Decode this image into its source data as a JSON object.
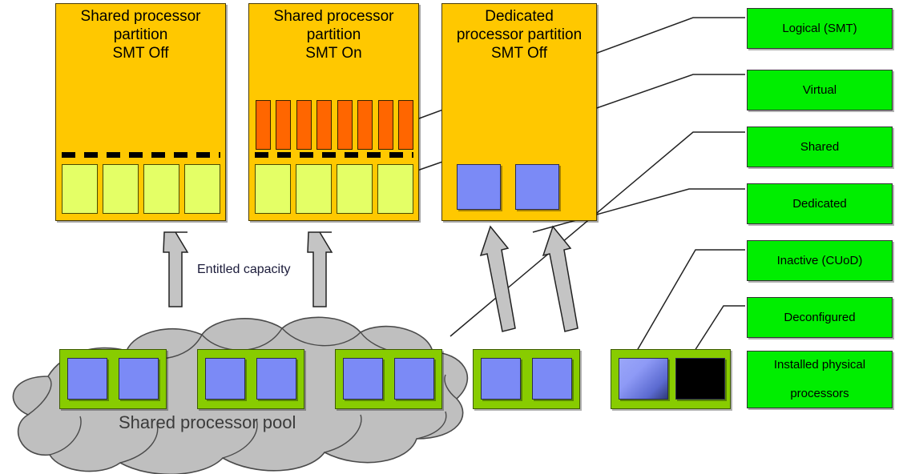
{
  "diagram": {
    "title_note": "POWER processor virtualization diagram",
    "colors": {
      "partition_fill": "#FFC800",
      "thread_fill": "#FF6600",
      "virtual_fill": "#E4FF66",
      "processor_blue": "#7B8AF6",
      "legend_green": "#00EE00",
      "pool_frame_green": "#88CC00",
      "cloud_gray": "#BFBFBF",
      "arrow_gray": "#C0C0C0",
      "deconfigured_black": "#000000"
    },
    "partitions": [
      {
        "id": "shared-smt-off",
        "title_lines": [
          "Shared processor",
          "partition",
          "SMT Off"
        ],
        "thread_count": 0,
        "virtual_count": 4,
        "dedicated_count": 0,
        "has_entitlement_line": true
      },
      {
        "id": "shared-smt-on",
        "title_lines": [
          "Shared processor",
          "partition",
          "SMT On"
        ],
        "thread_count": 8,
        "virtual_count": 4,
        "dedicated_count": 0,
        "has_entitlement_line": true
      },
      {
        "id": "dedicated-smt-off",
        "title_lines": [
          "Dedicated",
          "processor partition",
          "SMT Off"
        ],
        "thread_count": 0,
        "virtual_count": 0,
        "dedicated_count": 2,
        "has_entitlement_line": false
      }
    ],
    "legend": [
      {
        "id": "logical-smt",
        "label": "Logical (SMT)"
      },
      {
        "id": "virtual",
        "label": "Virtual"
      },
      {
        "id": "shared",
        "label": "Shared"
      },
      {
        "id": "dedicated",
        "label": "Dedicated"
      },
      {
        "id": "inactive-cuod",
        "label": "Inactive (CUoD)"
      },
      {
        "id": "deconfigured",
        "label": "Deconfigured"
      },
      {
        "id": "installed-physical",
        "label_lines": [
          "Installed physical",
          "processors"
        ]
      }
    ],
    "cloud": {
      "label": "Shared processor pool",
      "groups": [
        {
          "id": "pool-group-1",
          "in_cloud": true,
          "chips": [
            "shared",
            "shared"
          ]
        },
        {
          "id": "pool-group-2",
          "in_cloud": true,
          "chips": [
            "shared",
            "shared"
          ]
        },
        {
          "id": "pool-group-3",
          "in_cloud": true,
          "chips": [
            "shared",
            "shared"
          ]
        },
        {
          "id": "pool-group-4",
          "in_cloud": false,
          "chips": [
            "shared",
            "shared"
          ]
        },
        {
          "id": "pool-group-5",
          "in_cloud": false,
          "chips": [
            "inactive",
            "deconfigured"
          ]
        }
      ]
    },
    "arrows": {
      "entitled_label": "Entitled capacity",
      "count": 4
    }
  }
}
